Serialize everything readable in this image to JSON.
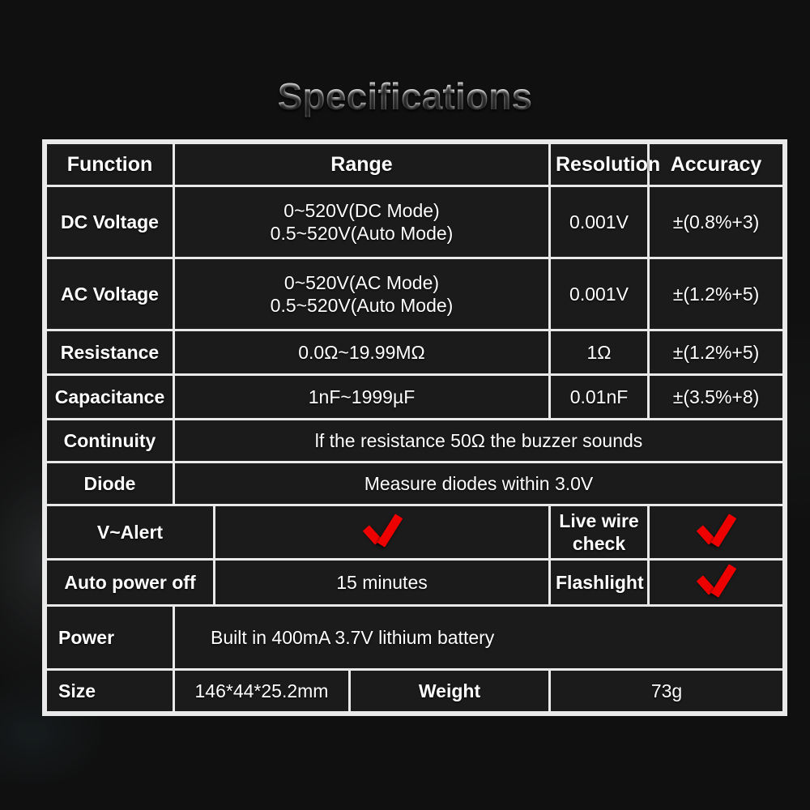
{
  "title": "Specifications",
  "theme": {
    "background": "#141414",
    "cell_background": "#1b1b1b",
    "grid_color": "#e9e9e9",
    "text_color": "#ffffff",
    "check_color": "#ee0000"
  },
  "table": {
    "headers": {
      "function": "Function",
      "range": "Range",
      "resolution": "Resolution",
      "accuracy": "Accuracy"
    },
    "measurement_rows": [
      {
        "function": "DC Voltage",
        "range_line1": "0~520V(DC Mode)",
        "range_line2": "0.5~520V(Auto Mode)",
        "resolution": "0.001V",
        "accuracy": "±(0.8%+3)"
      },
      {
        "function": "AC Voltage",
        "range_line1": "0~520V(AC Mode)",
        "range_line2": "0.5~520V(Auto Mode)",
        "resolution": "0.001V",
        "accuracy": "±(1.2%+5)"
      },
      {
        "function": "Resistance",
        "range_line1": "0.0Ω~19.99MΩ",
        "range_line2": "",
        "resolution": "1Ω",
        "accuracy": "±(1.2%+5)"
      },
      {
        "function": "Capacitance",
        "range_line1": "1nF~1999µF",
        "range_line2": "",
        "resolution": "0.01nF",
        "accuracy": "±(3.5%+8)"
      }
    ],
    "description_rows": [
      {
        "function": "Continuity",
        "description": "lf the resistance 50Ω the buzzer sounds"
      },
      {
        "function": "Diode",
        "description": "Measure diodes within 3.0V"
      }
    ],
    "feature_rows": [
      {
        "label_left": "V~Alert",
        "value_left": "check-mark",
        "label_right": "Live wire check",
        "value_right": "check-mark"
      },
      {
        "label_left": "Auto power off",
        "value_left": "15 minutes",
        "label_right": "Flashlight",
        "value_right": "check-mark"
      }
    ],
    "power_row": {
      "label": "Power",
      "value": "Built in 400mA 3.7V lithium battery"
    },
    "size_row": {
      "label": "Size",
      "value": "146*44*25.2mm",
      "label2": "Weight",
      "value2": "73g"
    }
  }
}
